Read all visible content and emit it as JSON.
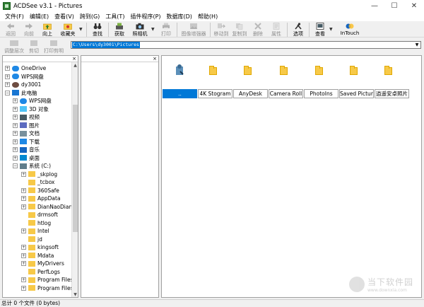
{
  "window": {
    "title": "ACDSee v3.1 - Pictures",
    "minimize": "—",
    "maximize": "☐",
    "close": "✕"
  },
  "menu": [
    "文件(F)",
    "编辑(E)",
    "查看(V)",
    "跨到(G)",
    "工具(T)",
    "插件程序(P)",
    "数据库(D)",
    "帮助(H)"
  ],
  "toolbar": {
    "back": "返回",
    "forward": "向前",
    "up": "向上",
    "favorites": "收藏夹",
    "find": "查找",
    "acquire": "获取",
    "camera": "照相机",
    "print": "打印",
    "image_enhancer": "图像增强器",
    "move_to": "移动到",
    "copy_to": "复制到",
    "delete": "删除",
    "properties": "属性",
    "options": "选项",
    "view": "查看",
    "intouch": "InTouch"
  },
  "toolbar2": {
    "adjust_order": "调整层次",
    "cut": "剪切",
    "print_preview": "打印剪明"
  },
  "address": {
    "path": "C:\\Users\\dy3001\\Pictures",
    "dropdown": "▼"
  },
  "panel_close": "×",
  "tree": [
    {
      "label": "OneDrive",
      "icon": "cloud-icon",
      "exp": "+"
    },
    {
      "label": "WPS网盘",
      "icon": "cloud-icon",
      "exp": "+"
    },
    {
      "label": "dy3001",
      "icon": "user-icon",
      "exp": "+"
    },
    {
      "label": "此电脑",
      "icon": "computer-icon",
      "exp": "−"
    },
    {
      "label": "WPS网盘",
      "icon": "cloud-icon",
      "exp": "+"
    },
    {
      "label": "3D 对象",
      "icon": "3d-objects-icon",
      "exp": "+"
    },
    {
      "label": "视频",
      "icon": "video-icon",
      "exp": "+"
    },
    {
      "label": "图片",
      "icon": "pictures-icon",
      "exp": "+"
    },
    {
      "label": "文档",
      "icon": "documents-icon",
      "exp": "+"
    },
    {
      "label": "下载",
      "icon": "download-icon",
      "exp": "+"
    },
    {
      "label": "音乐",
      "icon": "music-icon",
      "exp": "+"
    },
    {
      "label": "桌面",
      "icon": "desktop-icon",
      "exp": "+"
    },
    {
      "label": "系统 (C:)",
      "icon": "drive-icon",
      "exp": "−"
    },
    {
      "label": "_skplog",
      "icon": "folder-icon",
      "exp": "+"
    },
    {
      "label": "_tcbox",
      "icon": "folder-icon",
      "exp": ""
    },
    {
      "label": "360Safe",
      "icon": "folder-icon",
      "exp": "+"
    },
    {
      "label": "AppData",
      "icon": "folder-icon",
      "exp": "+"
    },
    {
      "label": "DianNaoDian",
      "icon": "folder-icon",
      "exp": "+"
    },
    {
      "label": "drmsoft",
      "icon": "folder-icon",
      "exp": ""
    },
    {
      "label": "htlog",
      "icon": "folder-icon",
      "exp": ""
    },
    {
      "label": "Intel",
      "icon": "folder-icon",
      "exp": "+"
    },
    {
      "label": "jd",
      "icon": "folder-icon",
      "exp": ""
    },
    {
      "label": "kingsoft",
      "icon": "folder-icon",
      "exp": "+"
    },
    {
      "label": "Mdata",
      "icon": "folder-icon",
      "exp": "+"
    },
    {
      "label": "MyDrivers",
      "icon": "folder-icon",
      "exp": "+"
    },
    {
      "label": "PerfLogs",
      "icon": "folder-icon",
      "exp": ""
    },
    {
      "label": "Program Files",
      "icon": "folder-icon",
      "exp": "+"
    },
    {
      "label": "Program Files (",
      "icon": "folder-icon",
      "exp": "+"
    }
  ],
  "files": [
    "..",
    "4K Stogram",
    "AnyDesk",
    "Camera Roll",
    "PhotoIns",
    "Saved Pictur...",
    "逍遥安卓照片"
  ],
  "status": "总计 0 个文件 (0 bytes)",
  "watermark": {
    "cn": "当下软件园",
    "en": "www.downxia.com"
  },
  "colors": {
    "selection": "#0078d7",
    "folder": "#f7c948"
  }
}
